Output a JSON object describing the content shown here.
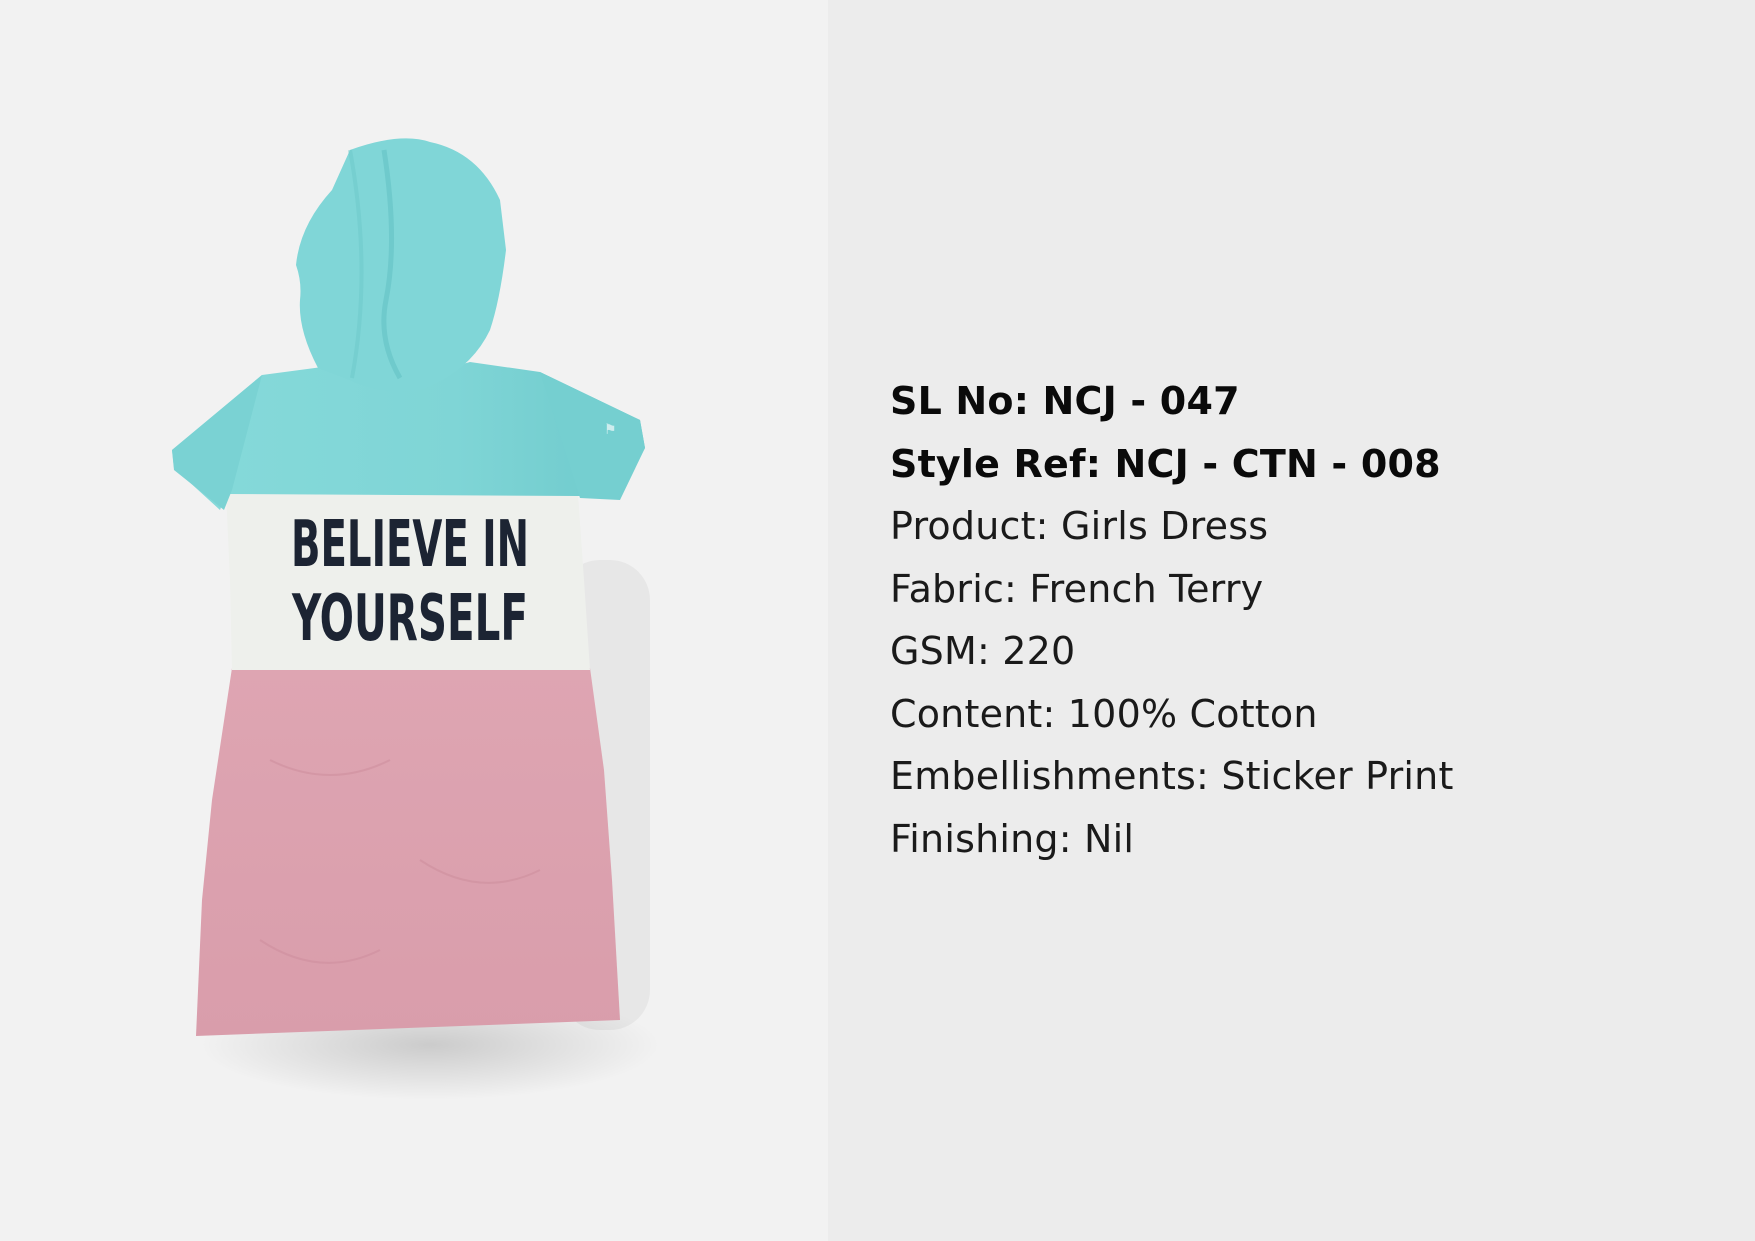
{
  "product_image": {
    "print_line1": "BELIEVE IN",
    "print_line2": "YOURSELF"
  },
  "specs": {
    "sl_no": "SL No: NCJ - 047",
    "style_ref": "Style Ref: NCJ - CTN - 008",
    "product": "Product: Girls Dress",
    "fabric": "Fabric: French Terry",
    "gsm": "GSM: 220",
    "content": "Content: 100% Cotton",
    "embellishments": "Embellishments: Sticker Print",
    "finishing": "Finishing: Nil"
  },
  "colors": {
    "hood_aqua": "#7fd6d6",
    "chest_white": "#eef0ec",
    "skirt_pink": "#dba0ae",
    "print_navy": "#1c2433"
  }
}
